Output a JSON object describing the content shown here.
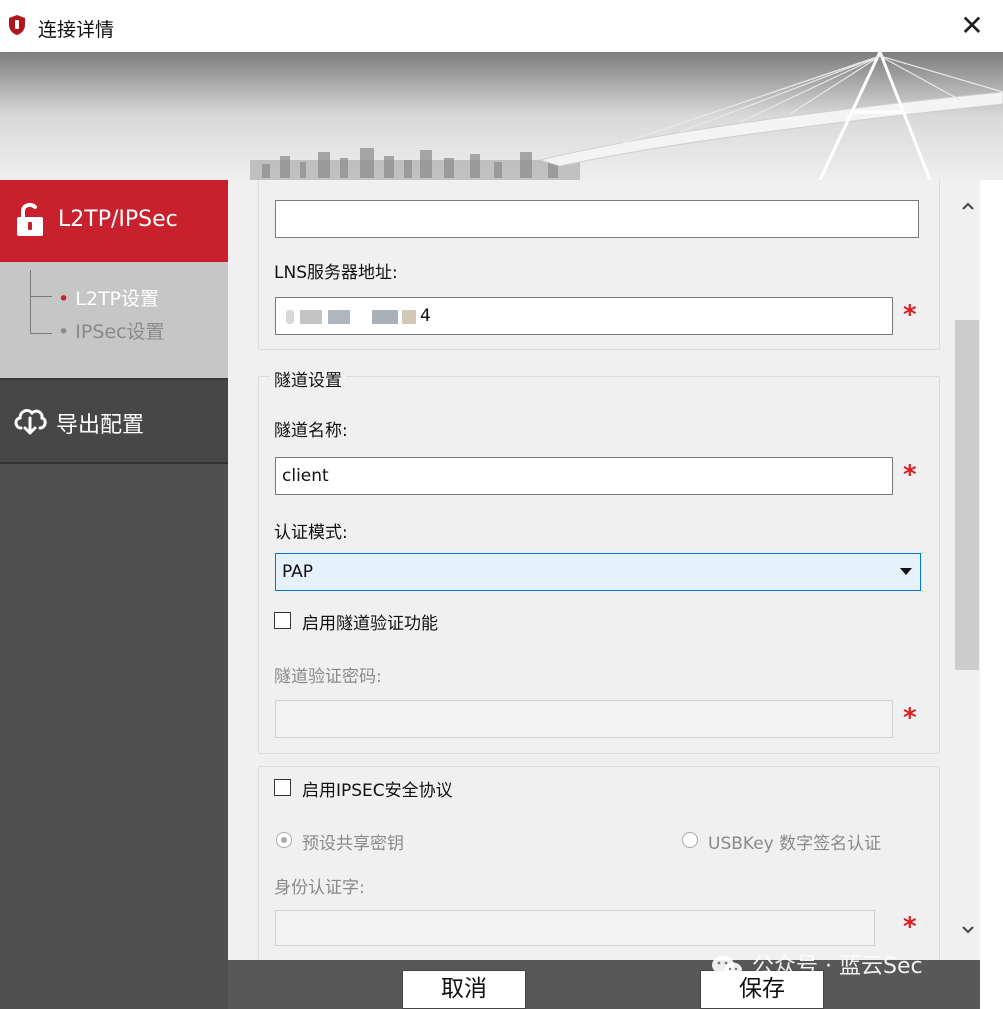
{
  "window": {
    "title": "连接详情",
    "close_glyph": "✕"
  },
  "sidebar": {
    "items": [
      {
        "label": "L2TP/IPSec",
        "icon": "unlock-icon",
        "active": true
      },
      {
        "label": "导出配置",
        "icon": "cloud-download-icon",
        "active": false
      }
    ],
    "subitems": [
      {
        "label": "L2TP设置",
        "bullet": "•",
        "active": true
      },
      {
        "label": "IPSec设置",
        "bullet": "•",
        "active": false
      }
    ]
  },
  "form": {
    "top_field_value": "",
    "lns_label": "LNS服务器地址:",
    "lns_value_suffix": "4",
    "tunnel_group_title": "隧道设置",
    "tunnel_name_label": "隧道名称:",
    "tunnel_name_value": "client",
    "auth_mode_label": "认证模式:",
    "auth_mode_value": "PAP",
    "enable_tunnel_auth_label": "启用隧道验证功能",
    "tunnel_auth_password_label": "隧道验证密码:",
    "tunnel_auth_password_value": "",
    "enable_ipsec_label": "启用IPSEC安全协议",
    "psk_label": "预设共享密钥",
    "usbkey_label": "USBKey 数字签名认证",
    "identity_label": "身份认证字:",
    "identity_value": "",
    "required_mark": "*"
  },
  "footer": {
    "cancel_label": "取消",
    "save_label": "保存",
    "watermark": "公众号 · 蓝云Sec"
  },
  "colors": {
    "accent": "#c8202c",
    "sidebar_bg": "#505050",
    "required": "#e01e1e"
  }
}
